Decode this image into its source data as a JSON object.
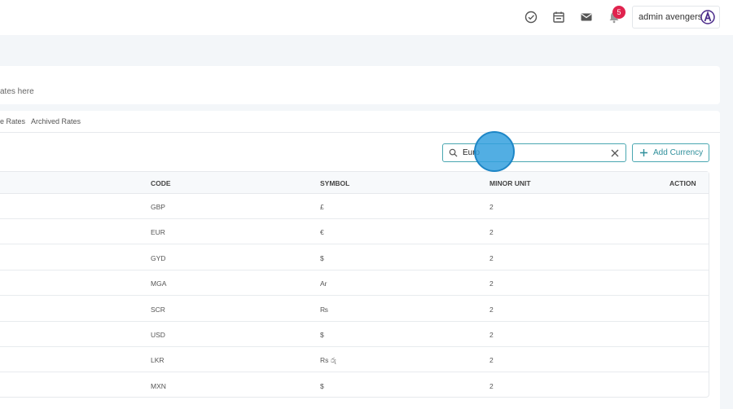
{
  "header": {
    "notification_count": "5",
    "user_name": "admin avengers",
    "icons": [
      "check-circle-icon",
      "calendar-icon",
      "mail-icon",
      "bell-icon"
    ]
  },
  "description": {
    "text": "ates here"
  },
  "tabs": [
    "e Rates",
    "Archived Rates"
  ],
  "toolbar": {
    "search_value": "Euro",
    "add_label": "Add Currency"
  },
  "table": {
    "columns": {
      "code": "CODE",
      "symbol": "SYMBOL",
      "minor_unit": "MINOR UNIT",
      "action": "ACTION"
    },
    "rows": [
      {
        "code": "GBP",
        "symbol": "£",
        "minor_unit": "2"
      },
      {
        "code": "EUR",
        "symbol": "€",
        "minor_unit": "2"
      },
      {
        "code": "GYD",
        "symbol": "$",
        "minor_unit": "2"
      },
      {
        "code": "MGA",
        "symbol": "Ar",
        "minor_unit": "2"
      },
      {
        "code": "SCR",
        "symbol": "₨",
        "minor_unit": "2"
      },
      {
        "code": "USD",
        "symbol": "$",
        "minor_unit": "2"
      },
      {
        "code": "LKR",
        "symbol": "Rs රු",
        "minor_unit": "2"
      },
      {
        "code": "MXN",
        "symbol": "$",
        "minor_unit": "2"
      }
    ]
  },
  "colors": {
    "accent": "#2f8f9b",
    "badge": "#e0234e",
    "page_bg": "#f3f6f9"
  }
}
